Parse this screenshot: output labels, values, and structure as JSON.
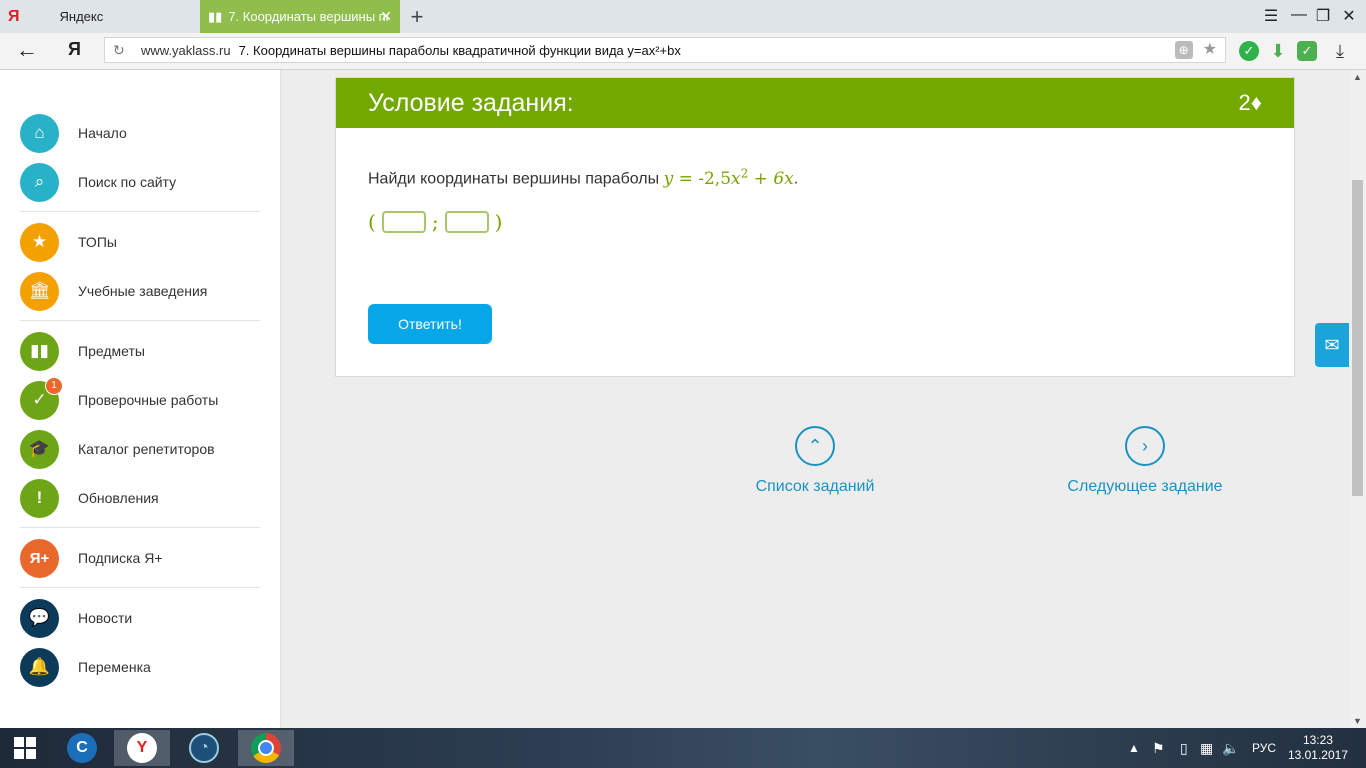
{
  "browser": {
    "tabs": [
      {
        "label": "Яндекс",
        "icon": "yandex-logo-icon"
      },
      {
        "label": "7. Координаты вершины параболы",
        "icon": "book-icon",
        "active": true
      }
    ],
    "address": {
      "domain": "www.yaklass.ru",
      "title": "7. Координаты вершины параболы квадратичной функции вида y=ax²+bx"
    },
    "logo_letter": "Я"
  },
  "sidebar": {
    "items": [
      {
        "label": "Начало",
        "icon": "home-icon",
        "color": "#28b2c8"
      },
      {
        "label": "Поиск по сайту",
        "icon": "search-icon",
        "color": "#28b2c8"
      },
      {
        "label": "ТОПы",
        "icon": "star-icon",
        "color": "#f2a100"
      },
      {
        "label": "Учебные заведения",
        "icon": "institution-icon",
        "color": "#f2a100"
      },
      {
        "label": "Предметы",
        "icon": "book-open-icon",
        "color": "#6ea517"
      },
      {
        "label": "Проверочные работы",
        "icon": "check-icon",
        "color": "#6ea517",
        "badge": "1"
      },
      {
        "label": "Каталог репетиторов",
        "icon": "graduation-cap-icon",
        "color": "#6ea517"
      },
      {
        "label": "Обновления",
        "icon": "exclamation-icon",
        "color": "#6ea517"
      },
      {
        "label": "Подписка Я+",
        "icon": "ya-plus-icon",
        "color": "#e8692b",
        "icon_text": "Я+"
      },
      {
        "label": "Новости",
        "icon": "chat-icon",
        "color": "#0b3b59"
      },
      {
        "label": "Переменка",
        "icon": "bell-icon",
        "color": "#0b3b59"
      }
    ]
  },
  "task": {
    "header_title": "Условие задания:",
    "score": "2♦",
    "question_text": "Найди координаты вершины параболы",
    "formula_lhs": "y",
    "formula_eq": " = -2,5",
    "formula_var": "x",
    "formula_exp": "2",
    "formula_rest": " + 6x",
    "formula_end": ".",
    "open_paren": "(",
    "separator": ";",
    "close_paren": ")",
    "input_x_value": "",
    "input_y_value": "",
    "submit_label": "Ответить!"
  },
  "navigation": {
    "list_label": "Список заданий",
    "next_label": "Следующее задание"
  },
  "taskbar": {
    "lang": "РУС",
    "time": "13:23",
    "date": "13.01.2017"
  }
}
